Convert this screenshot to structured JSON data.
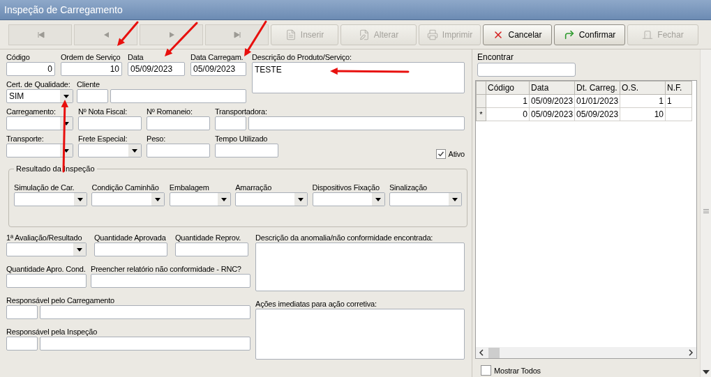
{
  "window": {
    "title": "Inspeção de Carregamento"
  },
  "toolbar": {
    "nav": [
      {
        "kind": "first",
        "disabled": true
      },
      {
        "kind": "prev",
        "disabled": true
      },
      {
        "kind": "next",
        "disabled": true
      },
      {
        "kind": "last",
        "disabled": true
      }
    ],
    "actions": [
      {
        "kind": "insert",
        "label": "Inserir",
        "disabled": true
      },
      {
        "kind": "edit",
        "label": "Alterar",
        "disabled": true
      },
      {
        "kind": "print",
        "label": "Imprimir",
        "disabled": true
      },
      {
        "kind": "cancel",
        "label": "Cancelar",
        "disabled": false
      },
      {
        "kind": "confirm",
        "label": "Confirmar",
        "disabled": false
      },
      {
        "kind": "close",
        "label": "Fechar",
        "disabled": true
      }
    ]
  },
  "form": {
    "row_1": [
      {
        "kind": "number",
        "label": "Código",
        "value": "0"
      },
      {
        "kind": "number",
        "label": "Ordem de Serviço",
        "value": "10"
      },
      {
        "kind": "text",
        "label": "Data",
        "value": "05/09/2023"
      },
      {
        "kind": "text",
        "label": "Data Carregam.",
        "value": "05/09/2023"
      }
    ],
    "description": {
      "label": "Descrição do Produto/Serviço:",
      "value": "TESTE"
    },
    "row_2": [
      {
        "kind": "select",
        "label": "Cert. de Qualidade:",
        "value": "SIM"
      },
      {
        "kind": "pair",
        "label": "Cliente"
      }
    ],
    "row_3": [
      {
        "kind": "select",
        "label": "Carregamento:"
      },
      {
        "kind": "text",
        "label": "Nº Nota Fiscal:"
      },
      {
        "kind": "text",
        "label": "Nº Romaneio:"
      },
      {
        "kind": "pair",
        "label": "Transportadora:"
      }
    ],
    "row_4": [
      {
        "kind": "select",
        "label": "Transporte:"
      },
      {
        "kind": "select",
        "label": "Frete Especial:"
      },
      {
        "kind": "text",
        "label": "Peso:"
      },
      {
        "kind": "text",
        "label": "Tempo Utilizado"
      }
    ],
    "active": {
      "label": "Ativo",
      "checked": true
    },
    "inspection": {
      "title": "Resultado da Inspeção",
      "fields": [
        {
          "kind": "select",
          "label": "Simulação de Car."
        },
        {
          "kind": "select",
          "label": "Condição Caminhão"
        },
        {
          "kind": "select",
          "label": "Embalagem"
        },
        {
          "kind": "select",
          "label": "Amarração"
        },
        {
          "kind": "select",
          "label": "Dispositivos Fixação"
        },
        {
          "kind": "select",
          "label": "Sinalização"
        }
      ]
    },
    "lower_left": [
      [
        {
          "kind": "select",
          "label": "1ª Avaliação/Resultado"
        },
        {
          "kind": "text",
          "label": "Quantidade Aprovada"
        },
        {
          "kind": "text",
          "label": "Quantidade Reprov."
        }
      ],
      [
        {
          "kind": "text",
          "label": "Quantidade Apro. Cond."
        },
        {
          "kind": "text",
          "label": "Preencher relatório não conformidade - RNC?"
        }
      ],
      [
        {
          "kind": "pair",
          "label": "Responsável pelo Carregamento"
        }
      ],
      [
        {
          "kind": "pair",
          "label": "Responsável pela Inspeção"
        }
      ]
    ],
    "lower_right": [
      {
        "label": "Descrição da anomalia/não conformidade encontrada:"
      },
      {
        "label": "Ações imediatas para ação corretiva:"
      }
    ]
  },
  "search": {
    "label": "Encontrar"
  },
  "grid": {
    "columns": [
      "Código",
      "Data",
      "Dt. Carreg.",
      "O.S.",
      "N.F."
    ],
    "rows": [
      {
        "cells": [
          "1",
          "05/09/2023",
          "01/01/2023",
          "1",
          "1"
        ]
      },
      {
        "marker": "*",
        "cells": [
          "0",
          "05/09/2023",
          "05/09/2023",
          "10",
          null
        ]
      }
    ]
  },
  "show_all": {
    "label": "Mostrar Todos",
    "checked": false
  }
}
